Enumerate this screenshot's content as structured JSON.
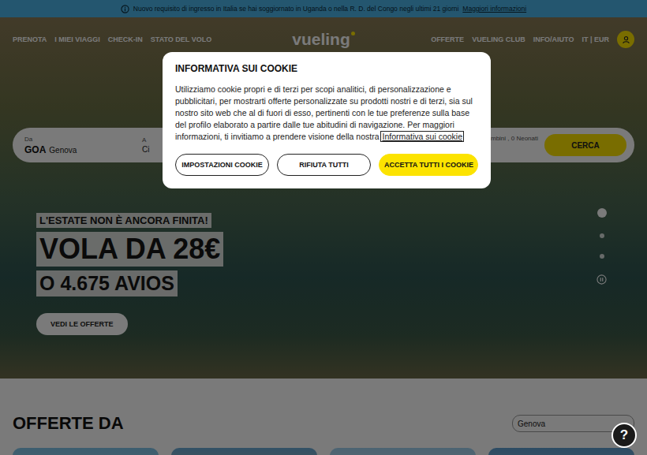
{
  "notice": {
    "text": "Nuovo requisito di ingresso in Italia se hai soggiornato in Uganda o nella R. D. del Congo negli ultimi 21 giorni",
    "link": "Maggiori informazioni"
  },
  "header": {
    "logo": "vueling",
    "nav_left": [
      "PRENOTA",
      "I MIEI VIAGGI",
      "CHECK-IN",
      "STATO DEL VOLO"
    ],
    "nav_right": [
      "OFFERTE",
      "VUELING CLUB",
      "INFO/AIUTO",
      "IT | EUR"
    ]
  },
  "search": {
    "fields": [
      {
        "label": "Da",
        "code": "GOA",
        "value": "Genova"
      },
      {
        "label": "A",
        "code": "",
        "value": "Ci"
      }
    ],
    "passengers": "mbini , 0 Neonati",
    "button": "CERCA"
  },
  "hero": {
    "tag": "L'ESTATE NON È ANCORA FINITA!",
    "headline": "VOLA DA 28€",
    "subline": "O 4.675 AVIOS",
    "button": "VEDI LE OFFERTE",
    "slides": [
      {
        "selected": true
      },
      {
        "selected": false
      },
      {
        "selected": false
      }
    ]
  },
  "offers": {
    "title": "OFFERTE DA",
    "origin": "Genova"
  },
  "cookie_dialog": {
    "title": "INFORMATIVA SUI COOKIE",
    "body": "Utilizziamo cookie propri e di terzi per scopi analitici, di personalizzazione e pubblicitari, per mostrarti offerte personalizzate su prodotti nostri e di terzi, sia sul nostro sito web che al di fuori di esso, pertinenti con le tue preferenze sulla base del profilo elaborato a partire dalle tue abitudini di navigazione. Per maggiori informazioni, ti invitiamo a prendere visione della nostra",
    "link": "Informativa sui cookie",
    "buttons": [
      {
        "label": "IMPOSTAZIONI COOKIE",
        "kind": "outline"
      },
      {
        "label": "RIFIUTA TUTTI",
        "kind": "outline"
      },
      {
        "label": "ACCETTA TUTTI I COOKIE",
        "kind": "primary"
      }
    ]
  },
  "help": {
    "label": "?"
  }
}
